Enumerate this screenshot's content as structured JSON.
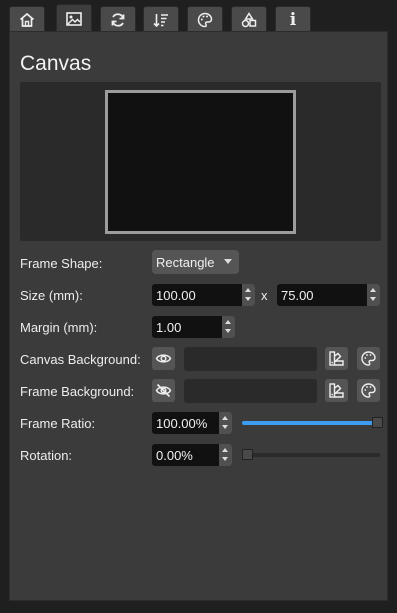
{
  "tabs": [
    {
      "icon": "home-icon"
    },
    {
      "icon": "image-icon",
      "active": true
    },
    {
      "icon": "refresh-icon"
    },
    {
      "icon": "sort-icon"
    },
    {
      "icon": "palette-icon"
    },
    {
      "icon": "shapes-icon"
    },
    {
      "icon": "info-icon",
      "glyph": "i"
    }
  ],
  "panel": {
    "title": "Canvas",
    "frame_shape": {
      "label": "Frame Shape:",
      "value": "Rectangle"
    },
    "size": {
      "label": "Size (mm):",
      "width": "100.00",
      "separator": "x",
      "height": "75.00"
    },
    "margin": {
      "label": "Margin (mm):",
      "value": "1.00"
    },
    "canvas_background": {
      "label": "Canvas Background:",
      "visibility_icon": "eye-icon"
    },
    "frame_background": {
      "label": "Frame Background:",
      "visibility_icon": "eye-off-icon"
    },
    "frame_ratio": {
      "label": "Frame Ratio:",
      "value": "100.00%",
      "level": 1.0
    },
    "rotation": {
      "label": "Rotation:",
      "value": "0.00%",
      "level": 0.0
    }
  },
  "colors": {
    "slider_fill": "#3d9bf0",
    "slider_empty": "#2a2a2a",
    "canvas_preview": "#111111"
  }
}
